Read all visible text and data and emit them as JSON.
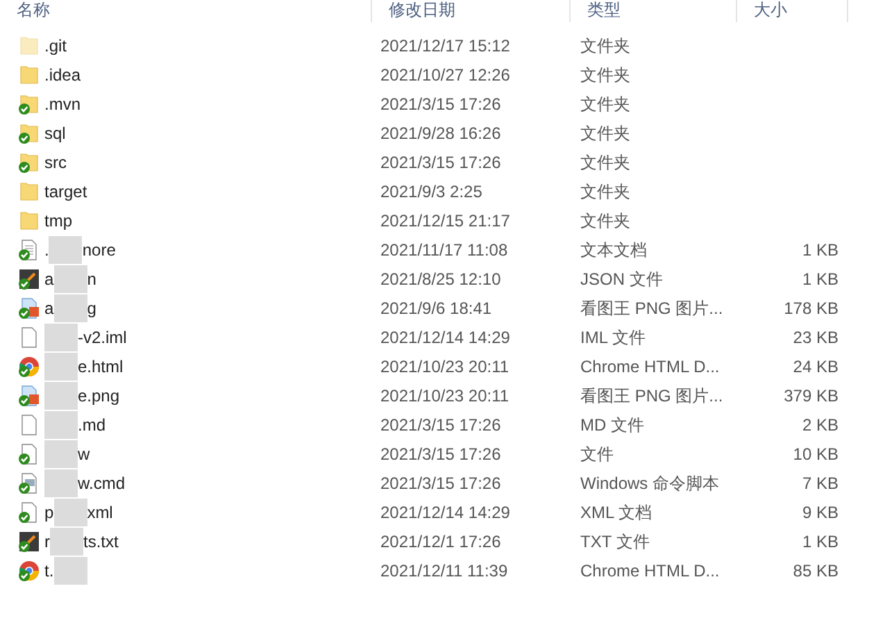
{
  "columns": [
    {
      "label": "名称"
    },
    {
      "label": "修改日期"
    },
    {
      "label": "类型"
    },
    {
      "label": "大小"
    }
  ],
  "files": [
    {
      "kind": "folder",
      "synced": false,
      "hidden": true,
      "name_start": ".git",
      "date": "2021/12/17 15:12",
      "type": "文件夹"
    },
    {
      "kind": "folder",
      "synced": false,
      "hidden": false,
      "name_start": ".idea",
      "date": "2021/10/27 12:26",
      "type": "文件夹"
    },
    {
      "kind": "folder",
      "synced": true,
      "hidden": false,
      "name_start": ".mvn",
      "date": "2021/3/15 17:26",
      "type": "文件夹"
    },
    {
      "kind": "folder",
      "synced": true,
      "hidden": false,
      "name_start": "sql",
      "date": "2021/9/28 16:26",
      "type": "文件夹"
    },
    {
      "kind": "folder",
      "synced": true,
      "hidden": false,
      "name_start": "src",
      "date": "2021/3/15 17:26",
      "type": "文件夹"
    },
    {
      "kind": "folder",
      "synced": false,
      "hidden": false,
      "name_start": "target",
      "date": "2021/9/3 2:25",
      "type": "文件夹"
    },
    {
      "kind": "folder",
      "synced": false,
      "hidden": false,
      "name_start": "tmp",
      "date": "2021/12/15 21:17",
      "type": "文件夹"
    },
    {
      "kind": "text",
      "synced": true,
      "hidden": false,
      "name_start": ".",
      "blurred": true,
      "name_end": "nore",
      "date": "2021/11/17 11:08",
      "type": "文本文档",
      "size": "1 KB"
    },
    {
      "kind": "app",
      "synced": true,
      "hidden": false,
      "name_start": "a",
      "blurred": true,
      "name_end": "n",
      "date": "2021/8/25 12:10",
      "type": "JSON 文件",
      "size": "1 KB"
    },
    {
      "kind": "image",
      "synced": true,
      "hidden": false,
      "name_start": "a",
      "blurred": true,
      "name_end": "g",
      "date": "2021/9/6 18:41",
      "type": "看图王 PNG 图片...",
      "size": "178 KB"
    },
    {
      "kind": "blank",
      "synced": false,
      "hidden": false,
      "blurred": true,
      "name_end": "-v2.iml",
      "date": "2021/12/14 14:29",
      "type": "IML 文件",
      "size": "23 KB"
    },
    {
      "kind": "chrome",
      "synced": true,
      "hidden": false,
      "blurred": true,
      "name_end": "e.html",
      "date": "2021/10/23 20:11",
      "type": "Chrome HTML D...",
      "size": "24 KB"
    },
    {
      "kind": "image",
      "synced": true,
      "hidden": false,
      "blurred": true,
      "name_end": "e.png",
      "date": "2021/10/23 20:11",
      "type": "看图王 PNG 图片...",
      "size": "379 KB"
    },
    {
      "kind": "blank",
      "synced": false,
      "hidden": false,
      "blurred": true,
      "name_end": ".md",
      "date": "2021/3/15 17:26",
      "type": "MD 文件",
      "size": "2 KB"
    },
    {
      "kind": "blank",
      "synced": true,
      "hidden": false,
      "blurred": true,
      "name_end": "w",
      "date": "2021/3/15 17:26",
      "type": "文件",
      "size": "10 KB"
    },
    {
      "kind": "cmd",
      "synced": true,
      "hidden": false,
      "blurred": true,
      "name_end": "w.cmd",
      "date": "2021/3/15 17:26",
      "type": "Windows 命令脚本",
      "size": "7 KB"
    },
    {
      "kind": "blank",
      "synced": true,
      "hidden": false,
      "name_start": "p",
      "blurred": true,
      "name_end": "xml",
      "date": "2021/12/14 14:29",
      "type": "XML 文档",
      "size": "9 KB"
    },
    {
      "kind": "app",
      "synced": true,
      "hidden": false,
      "name_start": "r",
      "blurred": true,
      "name_end": "ts.txt",
      "date": "2021/12/1 17:26",
      "type": "TXT 文件",
      "size": "1 KB"
    },
    {
      "kind": "chrome",
      "synced": true,
      "hidden": false,
      "name_start": "t.",
      "blurred": true,
      "date": "2021/12/11 11:39",
      "type": "Chrome HTML D...",
      "size": "85 KB"
    }
  ]
}
